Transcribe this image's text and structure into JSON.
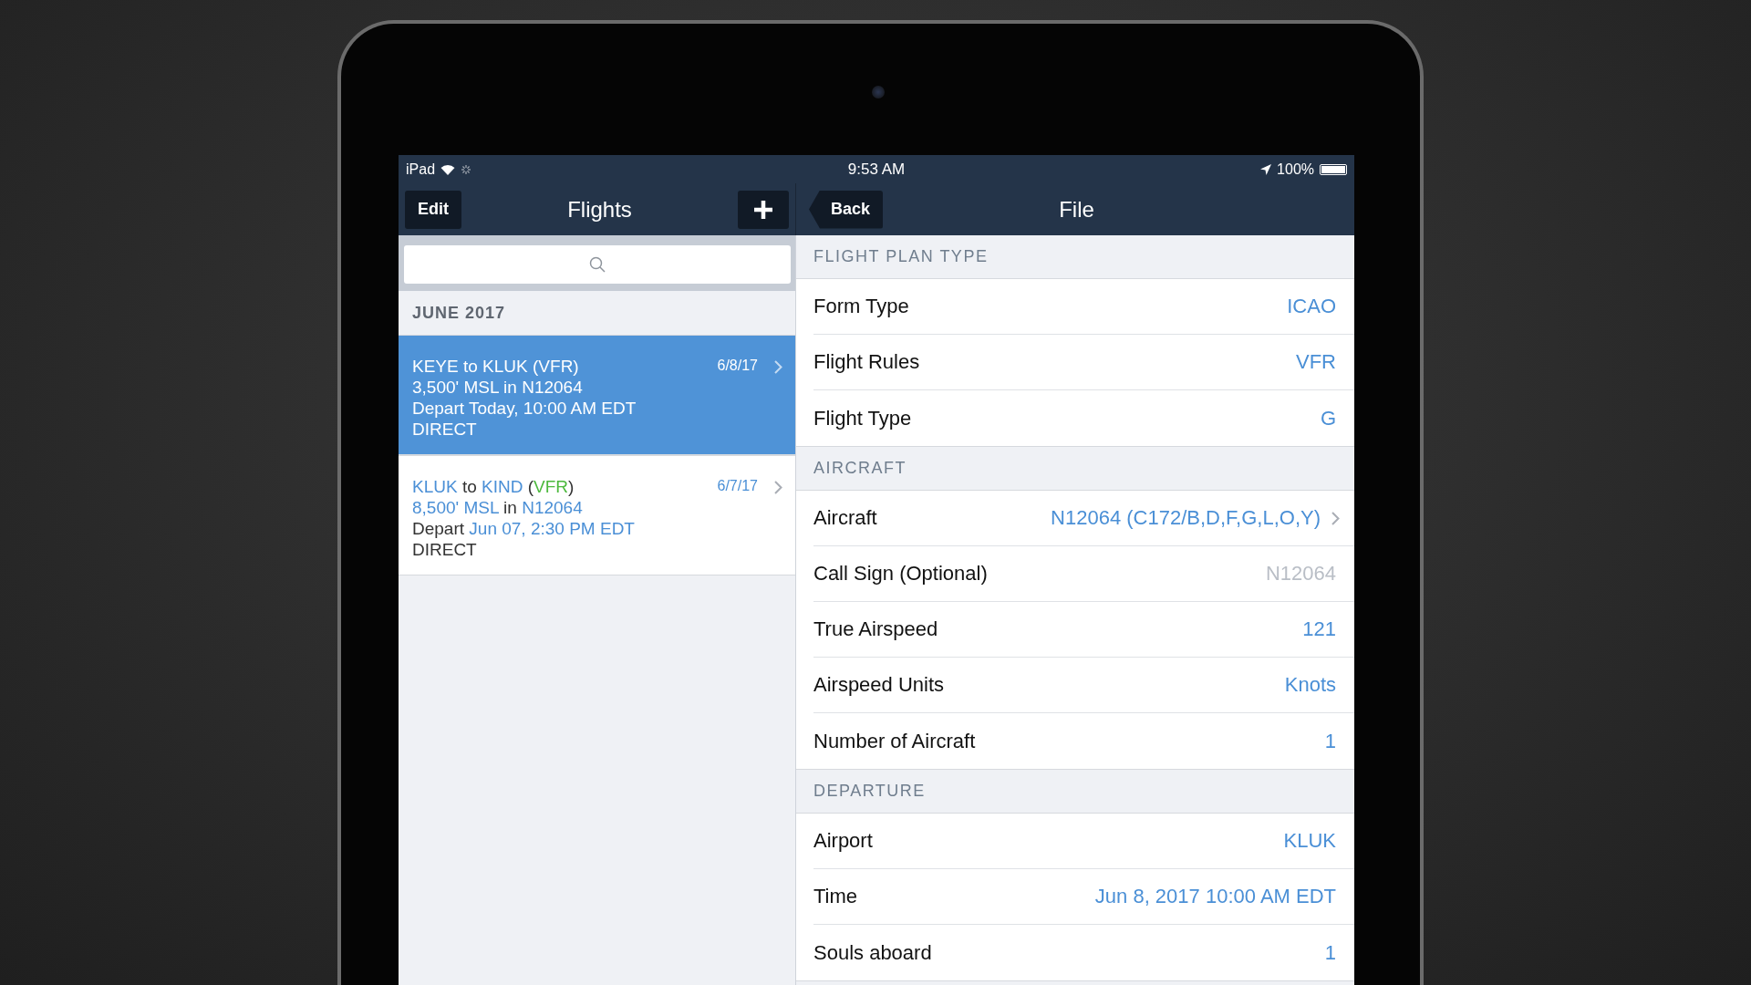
{
  "status_bar": {
    "device": "iPad",
    "time": "9:53 AM",
    "battery": "100%"
  },
  "master_nav": {
    "edit": "Edit",
    "title": "Flights"
  },
  "detail_nav": {
    "back": "Back",
    "title": "File"
  },
  "flights": {
    "section": "JUNE 2017",
    "items": [
      {
        "selected": true,
        "date": "6/8/17",
        "lines": [
          [
            {
              "text": "KEYE",
              "kind": "value"
            },
            {
              "text": " to ",
              "kind": "plain"
            },
            {
              "text": "KLUK",
              "kind": "value"
            },
            {
              "text": " (",
              "kind": "plain"
            },
            {
              "text": "VFR",
              "kind": "rules"
            },
            {
              "text": ")",
              "kind": "plain"
            }
          ],
          [
            {
              "text": "3,500' MSL",
              "kind": "value"
            },
            {
              "text": " in ",
              "kind": "plain"
            },
            {
              "text": "N12064",
              "kind": "value"
            }
          ],
          [
            {
              "text": "Depart ",
              "kind": "plain"
            },
            {
              "text": "Today, 10:00 AM EDT",
              "kind": "value"
            }
          ],
          [
            {
              "text": "DIRECT",
              "kind": "plain"
            }
          ]
        ]
      },
      {
        "selected": false,
        "date": "6/7/17",
        "lines": [
          [
            {
              "text": "KLUK",
              "kind": "value"
            },
            {
              "text": " to ",
              "kind": "plain"
            },
            {
              "text": "KIND",
              "kind": "value"
            },
            {
              "text": " (",
              "kind": "plain"
            },
            {
              "text": "VFR",
              "kind": "rules"
            },
            {
              "text": ")",
              "kind": "plain"
            }
          ],
          [
            {
              "text": "8,500' MSL",
              "kind": "value"
            },
            {
              "text": " in ",
              "kind": "plain"
            },
            {
              "text": "N12064",
              "kind": "value"
            }
          ],
          [
            {
              "text": "Depart ",
              "kind": "plain"
            },
            {
              "text": "Jun 07, 2:30 PM EDT",
              "kind": "value"
            }
          ],
          [
            {
              "text": "DIRECT",
              "kind": "plain"
            }
          ]
        ]
      }
    ]
  },
  "form": [
    {
      "title": "FLIGHT PLAN TYPE",
      "rows": [
        {
          "label": "Form Type",
          "value": "ICAO",
          "disclosure": false
        },
        {
          "label": "Flight Rules",
          "value": "VFR",
          "disclosure": false
        },
        {
          "label": "Flight Type",
          "value": "G",
          "disclosure": false
        }
      ]
    },
    {
      "title": "AIRCRAFT",
      "rows": [
        {
          "label": "Aircraft",
          "value": "N12064 (C172/B,D,F,G,L,O,Y)",
          "disclosure": true
        },
        {
          "label": "Call Sign (Optional)",
          "placeholder": "N12064",
          "disclosure": false
        },
        {
          "label": "True Airspeed",
          "value": "121",
          "disclosure": false
        },
        {
          "label": "Airspeed Units",
          "value": "Knots",
          "disclosure": false
        },
        {
          "label": "Number of Aircraft",
          "value": "1",
          "disclosure": false
        }
      ]
    },
    {
      "title": "DEPARTURE",
      "rows": [
        {
          "label": "Airport",
          "value": "KLUK",
          "disclosure": false
        },
        {
          "label": "Time",
          "value": "Jun 8, 2017 10:00 AM EDT",
          "disclosure": false
        },
        {
          "label": "Souls aboard",
          "value": "1",
          "disclosure": false
        }
      ]
    }
  ]
}
